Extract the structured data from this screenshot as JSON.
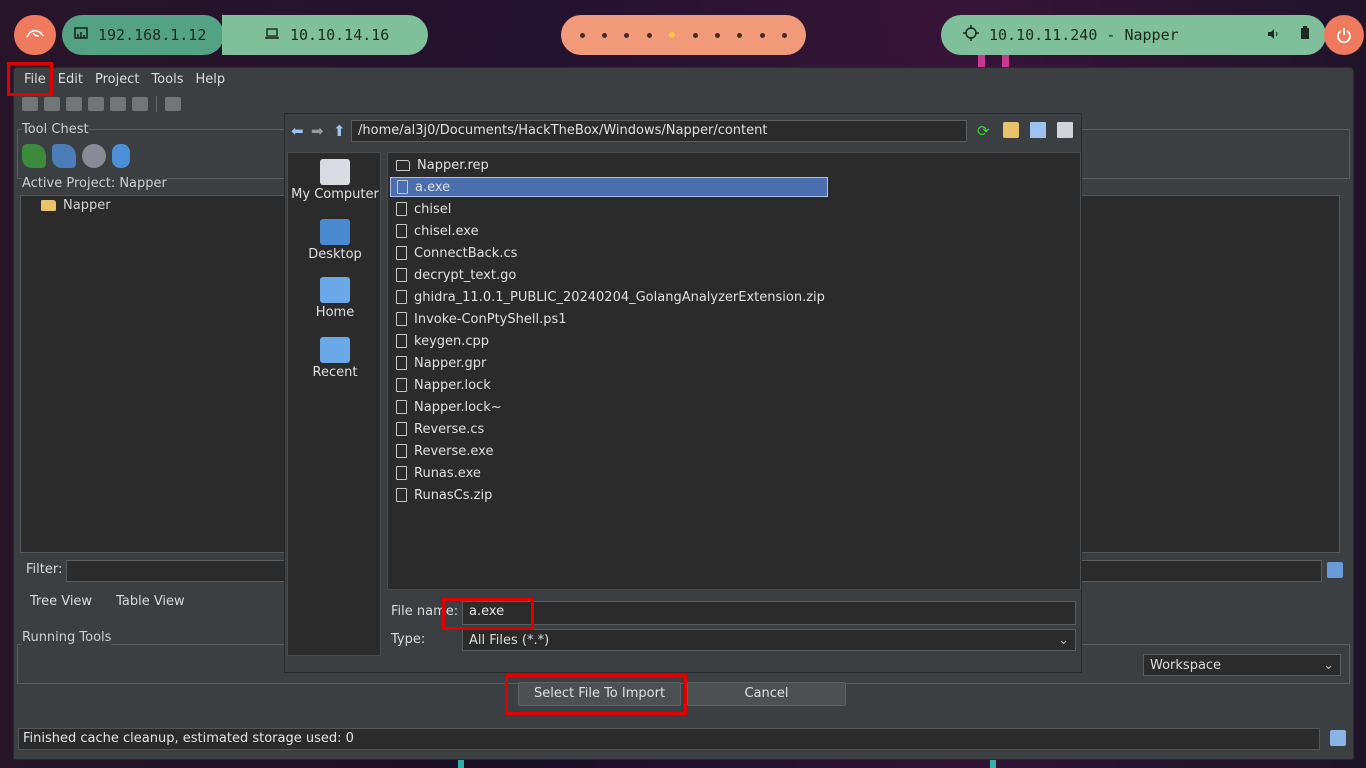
{
  "topbar": {
    "ip1": "192.168.1.12",
    "ip2": "10.10.14.16",
    "target": "10.10.11.240 - Napper",
    "workspaces": [
      1,
      2,
      3,
      4,
      5,
      6,
      7,
      8,
      9,
      10
    ],
    "active_workspace": 5
  },
  "menu": [
    "File",
    "Edit",
    "Project",
    "Tools",
    "Help"
  ],
  "tool_chest_label": "Tool Chest",
  "active_project_label": "Active Project: Napper",
  "project_root": "Napper",
  "filter_label": "Filter:",
  "tabs": [
    "Tree View",
    "Table View"
  ],
  "running_tools_label": "Running Tools",
  "workspace_select": "Workspace",
  "status_text": "Finished cache cleanup, estimated storage used: 0",
  "dialog": {
    "path": "/home/al3j0/Documents/HackTheBox/Windows/Napper/content",
    "places": [
      "My Computer",
      "Desktop",
      "Home",
      "Recent"
    ],
    "files": [
      {
        "name": "Napper.rep",
        "type": "folder"
      },
      {
        "name": "a.exe",
        "type": "file",
        "selected": true
      },
      {
        "name": "chisel",
        "type": "file"
      },
      {
        "name": "chisel.exe",
        "type": "file"
      },
      {
        "name": "ConnectBack.cs",
        "type": "file"
      },
      {
        "name": "decrypt_text.go",
        "type": "file"
      },
      {
        "name": "ghidra_11.0.1_PUBLIC_20240204_GolangAnalyzerExtension.zip",
        "type": "file"
      },
      {
        "name": "Invoke-ConPtyShell.ps1",
        "type": "file"
      },
      {
        "name": "keygen.cpp",
        "type": "file"
      },
      {
        "name": "Napper.gpr",
        "type": "file"
      },
      {
        "name": "Napper.lock",
        "type": "file"
      },
      {
        "name": "Napper.lock~",
        "type": "file"
      },
      {
        "name": "Reverse.cs",
        "type": "file"
      },
      {
        "name": "Reverse.exe",
        "type": "file"
      },
      {
        "name": "Runas.exe",
        "type": "file"
      },
      {
        "name": "RunasCs.zip",
        "type": "file"
      }
    ],
    "file_name_label": "File name:",
    "file_name_value": "a.exe",
    "type_label": "Type:",
    "type_value": "All Files (*.*)",
    "select_button": "Select File To Import",
    "cancel_button": "Cancel"
  },
  "colors": {
    "highlight": "#e00000",
    "selection": "#4b6eaf"
  }
}
